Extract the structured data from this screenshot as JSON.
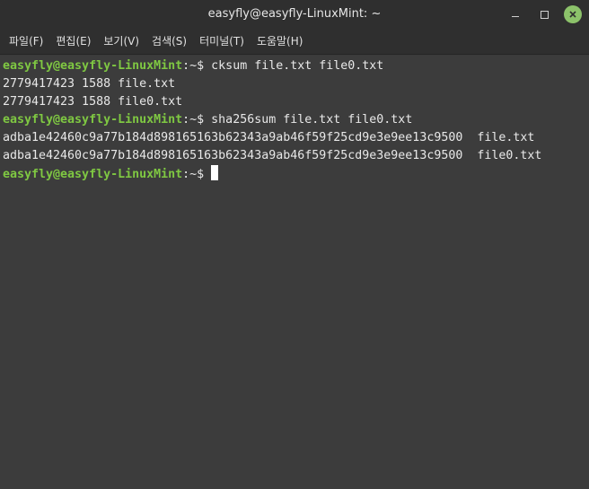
{
  "window": {
    "title": "easyfly@easyfly-LinuxMint: ~"
  },
  "menubar": {
    "items": [
      {
        "label": "파일(F)"
      },
      {
        "label": "편집(E)"
      },
      {
        "label": "보기(V)"
      },
      {
        "label": "검색(S)"
      },
      {
        "label": "터미널(T)"
      },
      {
        "label": "도움말(H)"
      }
    ]
  },
  "terminal": {
    "prompt_user_host": "easyfly@easyfly-LinuxMint",
    "prompt_sep": ":~$ ",
    "commands": {
      "cmd1": "cksum file.txt file0.txt",
      "out1a": "2779417423 1588 file.txt",
      "out1b": "2779417423 1588 file0.txt",
      "cmd2": "sha256sum file.txt file0.txt",
      "out2a": "adba1e42460c9a77b184d898165163b62343a9ab46f59f25cd9e3e9ee13c9500  file.txt",
      "out2b": "adba1e42460c9a77b184d898165163b62343a9ab46f59f25cd9e3e9ee13c9500  file0.txt"
    }
  },
  "colors": {
    "prompt_green": "#7fc842",
    "close_button": "#8cc26a",
    "terminal_bg": "#3c3c3c"
  },
  "icons": {
    "minimize": "minimize-icon",
    "maximize": "maximize-icon",
    "close": "close-icon"
  }
}
